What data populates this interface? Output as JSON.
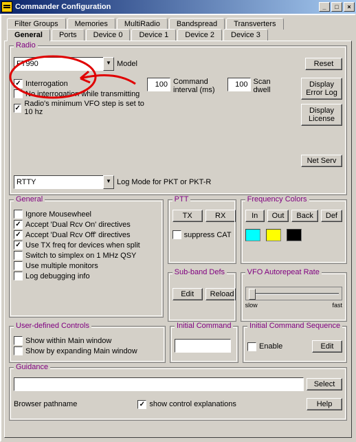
{
  "window": {
    "title": "Commander Configuration"
  },
  "tabs_top": [
    {
      "label": "Filter Groups",
      "u": "F"
    },
    {
      "label": "Memories",
      "u": "e"
    },
    {
      "label": "MultiRadio",
      "u": "u"
    },
    {
      "label": "Bandspread",
      "u": "B"
    },
    {
      "label": "Transverters",
      "u": "T"
    }
  ],
  "tabs_bottom": [
    {
      "label": "General",
      "u": "G",
      "active": true
    },
    {
      "label": "Ports",
      "u": "P"
    },
    {
      "label": "Device 0",
      "u": "0"
    },
    {
      "label": "Device 1",
      "u": "1"
    },
    {
      "label": "Device 2",
      "u": "2"
    },
    {
      "label": "Device 3",
      "u": "3"
    }
  ],
  "radio": {
    "title": "Radio",
    "model_value": "FT990",
    "model_label": "Model",
    "reset_btn": "Reset",
    "interrogation": {
      "checked": true,
      "label": "Interrogation"
    },
    "no_int_tx": {
      "checked": false,
      "label": "No interrogation while transmitting"
    },
    "min_vfo": {
      "checked": true,
      "label": "Radio's minimum VFO step is set to 10 hz"
    },
    "cmd_interval_value": "100",
    "cmd_interval_label": "Command\ninterval (ms)",
    "scan_dwell_value": "100",
    "scan_dwell_label": "Scan\ndwell",
    "display_errorlog_btn": "Display\nError Log",
    "display_license_btn": "Display\nLicense",
    "net_serv_btn": "Net Serv",
    "log_mode_value": "RTTY",
    "log_mode_label": "Log Mode for PKT or PKT-R"
  },
  "general": {
    "title": "General",
    "items": [
      {
        "checked": false,
        "label": "Ignore Mousewheel"
      },
      {
        "checked": true,
        "label": "Accept 'Dual Rcv On' directives"
      },
      {
        "checked": true,
        "label": "Accept 'Dual Rcv Off' directives"
      },
      {
        "checked": true,
        "label": "Use TX freq for devices when split"
      },
      {
        "checked": false,
        "label": "Switch to simplex on 1 MHz QSY"
      },
      {
        "checked": false,
        "label": "Use multiple monitors"
      },
      {
        "checked": false,
        "label": "Log debugging info"
      }
    ]
  },
  "ptt": {
    "title": "PTT",
    "tx": "TX",
    "rx": "RX",
    "suppress": {
      "checked": false,
      "label": "suppress CAT"
    }
  },
  "freq_colors": {
    "title": "Frequency Colors",
    "in": "In",
    "out": "Out",
    "back": "Back",
    "def": "Def",
    "colors": [
      "#00ffff",
      "#ffff00",
      "#000000"
    ]
  },
  "subband": {
    "title": "Sub-band Defs",
    "edit": "Edit",
    "reload": "Reload"
  },
  "vfo_auto": {
    "title": "VFO Autorepeat Rate",
    "slow": "slow",
    "fast": "fast"
  },
  "user_ctrls": {
    "title": "User-defined Controls",
    "items": [
      {
        "checked": false,
        "label": "Show within Main window"
      },
      {
        "checked": false,
        "label": "Show by expanding Main window"
      }
    ]
  },
  "init_cmd": {
    "title": "Initial Command",
    "value": ""
  },
  "init_seq": {
    "title": "Initial Command Sequence",
    "enable": {
      "checked": false,
      "label": "Enable"
    },
    "edit": "Edit"
  },
  "guidance": {
    "title": "Guidance",
    "pathname": "",
    "pathname_label": "Browser pathname",
    "show_expl": {
      "checked": true,
      "label": "show control explanations"
    },
    "select": "Select",
    "help": "Help"
  }
}
